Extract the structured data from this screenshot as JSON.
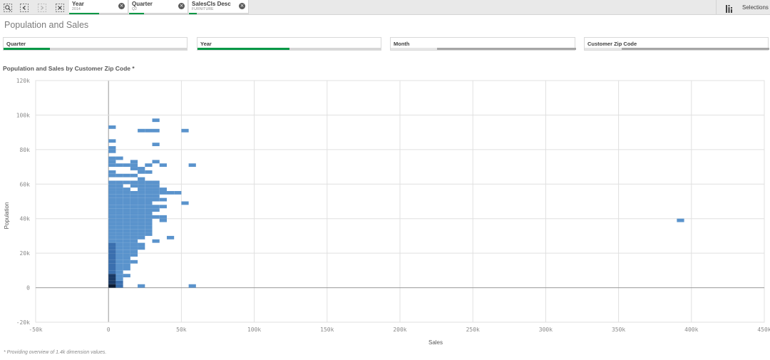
{
  "toolbar": {
    "icons": [
      "smart-search-icon",
      "step-back-icon",
      "step-forward-icon",
      "clear-selections-icon"
    ],
    "selections_label": "Selections",
    "selection_tabs": [
      {
        "title": "Year",
        "value": "2014",
        "progress": 0.5
      },
      {
        "title": "Quarter",
        "value": "Q2",
        "progress": 0.25
      },
      {
        "title": "SalesCls Desc",
        "value": "FURNITURE",
        "progress": 0.1
      }
    ]
  },
  "sheet": {
    "title": "Population and Sales"
  },
  "filters": [
    {
      "label": "Quarter",
      "selected_fraction": 0.25,
      "excluded_fraction": 0
    },
    {
      "label": "Year",
      "selected_fraction": 0.5,
      "excluded_fraction": 0
    },
    {
      "label": "Month",
      "selected_fraction": 0,
      "excluded_fraction": 0.75
    },
    {
      "label": "Customer Zip Code",
      "selected_fraction": 0,
      "excluded_fraction": 0.8
    }
  ],
  "chart": {
    "title": "Population and Sales by Customer Zip Code *",
    "footnote": "* Providing overview of 1.4k dimension values."
  },
  "chart_data": {
    "type": "heatmap",
    "title": "Population and Sales by Customer Zip Code *",
    "xlabel": "Sales",
    "ylabel": "Population",
    "xlim": [
      -50000,
      450000
    ],
    "ylim": [
      -20000,
      120000
    ],
    "x_ticks": [
      "-50k",
      "0",
      "50k",
      "100k",
      "150k",
      "200k",
      "250k",
      "300k",
      "350k",
      "400k",
      "450k"
    ],
    "y_ticks": [
      "-20k",
      "0",
      "20k",
      "40k",
      "60k",
      "80k",
      "100k",
      "120k"
    ],
    "grid": true,
    "bin_width": 5000,
    "bin_height": 2000,
    "colors": {
      "light": "#5a93cc",
      "mid": "#3a6fae",
      "dark": "#1a3a66",
      "darkest": "#0b1b33",
      "grid": "#e0e0e0",
      "axis_zero": "#9a9a9a"
    },
    "cells": [
      {
        "x": 0,
        "y": 0,
        "density": 4
      },
      {
        "x": 0,
        "y": 2000,
        "density": 3
      },
      {
        "x": 0,
        "y": 4000,
        "density": 3
      },
      {
        "x": 0,
        "y": 6000,
        "density": 3
      },
      {
        "x": 0,
        "y": 8000,
        "density": 2
      },
      {
        "x": 0,
        "y": 10000,
        "density": 2
      },
      {
        "x": 0,
        "y": 12000,
        "density": 2
      },
      {
        "x": 0,
        "y": 14000,
        "density": 2
      },
      {
        "x": 0,
        "y": 16000,
        "density": 2
      },
      {
        "x": 0,
        "y": 18000,
        "density": 2
      },
      {
        "x": 0,
        "y": 20000,
        "density": 2
      },
      {
        "x": 0,
        "y": 22000,
        "density": 2
      },
      {
        "x": 0,
        "y": 24000,
        "density": 2
      },
      {
        "x": 0,
        "y": 26000,
        "density": 1
      },
      {
        "x": 0,
        "y": 28000,
        "density": 1
      },
      {
        "x": 0,
        "y": 30000,
        "density": 1
      },
      {
        "x": 0,
        "y": 32000,
        "density": 1
      },
      {
        "x": 0,
        "y": 34000,
        "density": 1
      },
      {
        "x": 0,
        "y": 36000,
        "density": 1
      },
      {
        "x": 0,
        "y": 38000,
        "density": 1
      },
      {
        "x": 0,
        "y": 40000,
        "density": 1
      },
      {
        "x": 0,
        "y": 42000,
        "density": 1
      },
      {
        "x": 0,
        "y": 44000,
        "density": 1
      },
      {
        "x": 0,
        "y": 46000,
        "density": 1
      },
      {
        "x": 0,
        "y": 48000,
        "density": 1
      },
      {
        "x": 0,
        "y": 50000,
        "density": 1
      },
      {
        "x": 0,
        "y": 52000,
        "density": 1
      },
      {
        "x": 0,
        "y": 54000,
        "density": 1
      },
      {
        "x": 0,
        "y": 56000,
        "density": 1
      },
      {
        "x": 0,
        "y": 58000,
        "density": 1
      },
      {
        "x": 0,
        "y": 60000,
        "density": 1
      },
      {
        "x": 0,
        "y": 64000,
        "density": 1
      },
      {
        "x": 0,
        "y": 66000,
        "density": 1
      },
      {
        "x": 0,
        "y": 70000,
        "density": 1
      },
      {
        "x": 0,
        "y": 72000,
        "density": 1
      },
      {
        "x": 0,
        "y": 74000,
        "density": 1
      },
      {
        "x": 0,
        "y": 78000,
        "density": 1
      },
      {
        "x": 0,
        "y": 80000,
        "density": 1
      },
      {
        "x": 0,
        "y": 84000,
        "density": 1
      },
      {
        "x": 0,
        "y": 92000,
        "density": 1
      },
      {
        "x": 5000,
        "y": 0,
        "density": 2
      },
      {
        "x": 5000,
        "y": 2000,
        "density": 2
      },
      {
        "x": 5000,
        "y": 4000,
        "density": 1
      },
      {
        "x": 5000,
        "y": 6000,
        "density": 1
      },
      {
        "x": 5000,
        "y": 8000,
        "density": 1
      },
      {
        "x": 5000,
        "y": 10000,
        "density": 1
      },
      {
        "x": 5000,
        "y": 12000,
        "density": 1
      },
      {
        "x": 5000,
        "y": 14000,
        "density": 1
      },
      {
        "x": 5000,
        "y": 16000,
        "density": 1
      },
      {
        "x": 5000,
        "y": 18000,
        "density": 1
      },
      {
        "x": 5000,
        "y": 20000,
        "density": 1
      },
      {
        "x": 5000,
        "y": 22000,
        "density": 1
      },
      {
        "x": 5000,
        "y": 24000,
        "density": 1
      },
      {
        "x": 5000,
        "y": 26000,
        "density": 1
      },
      {
        "x": 5000,
        "y": 28000,
        "density": 1
      },
      {
        "x": 5000,
        "y": 30000,
        "density": 1
      },
      {
        "x": 5000,
        "y": 32000,
        "density": 1
      },
      {
        "x": 5000,
        "y": 34000,
        "density": 1
      },
      {
        "x": 5000,
        "y": 36000,
        "density": 1
      },
      {
        "x": 5000,
        "y": 38000,
        "density": 1
      },
      {
        "x": 5000,
        "y": 40000,
        "density": 1
      },
      {
        "x": 5000,
        "y": 42000,
        "density": 1
      },
      {
        "x": 5000,
        "y": 44000,
        "density": 1
      },
      {
        "x": 5000,
        "y": 46000,
        "density": 1
      },
      {
        "x": 5000,
        "y": 48000,
        "density": 1
      },
      {
        "x": 5000,
        "y": 50000,
        "density": 1
      },
      {
        "x": 5000,
        "y": 52000,
        "density": 1
      },
      {
        "x": 5000,
        "y": 54000,
        "density": 1
      },
      {
        "x": 5000,
        "y": 56000,
        "density": 1
      },
      {
        "x": 5000,
        "y": 58000,
        "density": 1
      },
      {
        "x": 5000,
        "y": 60000,
        "density": 1
      },
      {
        "x": 5000,
        "y": 64000,
        "density": 1
      },
      {
        "x": 5000,
        "y": 70000,
        "density": 1
      },
      {
        "x": 5000,
        "y": 74000,
        "density": 1
      },
      {
        "x": 10000,
        "y": 6000,
        "density": 1
      },
      {
        "x": 10000,
        "y": 10000,
        "density": 1
      },
      {
        "x": 10000,
        "y": 12000,
        "density": 1
      },
      {
        "x": 10000,
        "y": 14000,
        "density": 1
      },
      {
        "x": 10000,
        "y": 16000,
        "density": 1
      },
      {
        "x": 10000,
        "y": 18000,
        "density": 1
      },
      {
        "x": 10000,
        "y": 20000,
        "density": 1
      },
      {
        "x": 10000,
        "y": 22000,
        "density": 1
      },
      {
        "x": 10000,
        "y": 24000,
        "density": 1
      },
      {
        "x": 10000,
        "y": 26000,
        "density": 1
      },
      {
        "x": 10000,
        "y": 28000,
        "density": 1
      },
      {
        "x": 10000,
        "y": 30000,
        "density": 1
      },
      {
        "x": 10000,
        "y": 32000,
        "density": 1
      },
      {
        "x": 10000,
        "y": 34000,
        "density": 1
      },
      {
        "x": 10000,
        "y": 36000,
        "density": 1
      },
      {
        "x": 10000,
        "y": 38000,
        "density": 1
      },
      {
        "x": 10000,
        "y": 40000,
        "density": 1
      },
      {
        "x": 10000,
        "y": 42000,
        "density": 1
      },
      {
        "x": 10000,
        "y": 44000,
        "density": 1
      },
      {
        "x": 10000,
        "y": 46000,
        "density": 1
      },
      {
        "x": 10000,
        "y": 48000,
        "density": 1
      },
      {
        "x": 10000,
        "y": 50000,
        "density": 1
      },
      {
        "x": 10000,
        "y": 52000,
        "density": 1
      },
      {
        "x": 10000,
        "y": 54000,
        "density": 1
      },
      {
        "x": 10000,
        "y": 56000,
        "density": 1
      },
      {
        "x": 10000,
        "y": 60000,
        "density": 1
      },
      {
        "x": 10000,
        "y": 64000,
        "density": 1
      },
      {
        "x": 10000,
        "y": 70000,
        "density": 1
      },
      {
        "x": 15000,
        "y": 14000,
        "density": 1
      },
      {
        "x": 15000,
        "y": 18000,
        "density": 1
      },
      {
        "x": 15000,
        "y": 20000,
        "density": 1
      },
      {
        "x": 15000,
        "y": 22000,
        "density": 1
      },
      {
        "x": 15000,
        "y": 24000,
        "density": 1
      },
      {
        "x": 15000,
        "y": 26000,
        "density": 1
      },
      {
        "x": 15000,
        "y": 28000,
        "density": 1
      },
      {
        "x": 15000,
        "y": 30000,
        "density": 1
      },
      {
        "x": 15000,
        "y": 32000,
        "density": 1
      },
      {
        "x": 15000,
        "y": 34000,
        "density": 1
      },
      {
        "x": 15000,
        "y": 36000,
        "density": 1
      },
      {
        "x": 15000,
        "y": 38000,
        "density": 1
      },
      {
        "x": 15000,
        "y": 40000,
        "density": 1
      },
      {
        "x": 15000,
        "y": 42000,
        "density": 1
      },
      {
        "x": 15000,
        "y": 44000,
        "density": 1
      },
      {
        "x": 15000,
        "y": 46000,
        "density": 1
      },
      {
        "x": 15000,
        "y": 48000,
        "density": 1
      },
      {
        "x": 15000,
        "y": 50000,
        "density": 1
      },
      {
        "x": 15000,
        "y": 52000,
        "density": 1
      },
      {
        "x": 15000,
        "y": 54000,
        "density": 1
      },
      {
        "x": 15000,
        "y": 58000,
        "density": 1
      },
      {
        "x": 15000,
        "y": 60000,
        "density": 1
      },
      {
        "x": 15000,
        "y": 64000,
        "density": 1
      },
      {
        "x": 15000,
        "y": 68000,
        "density": 1
      },
      {
        "x": 15000,
        "y": 70000,
        "density": 1
      },
      {
        "x": 15000,
        "y": 72000,
        "density": 1
      },
      {
        "x": 20000,
        "y": 0,
        "density": 1
      },
      {
        "x": 20000,
        "y": 22000,
        "density": 1
      },
      {
        "x": 20000,
        "y": 24000,
        "density": 1
      },
      {
        "x": 20000,
        "y": 28000,
        "density": 1
      },
      {
        "x": 20000,
        "y": 30000,
        "density": 1
      },
      {
        "x": 20000,
        "y": 32000,
        "density": 1
      },
      {
        "x": 20000,
        "y": 34000,
        "density": 1
      },
      {
        "x": 20000,
        "y": 36000,
        "density": 1
      },
      {
        "x": 20000,
        "y": 38000,
        "density": 1
      },
      {
        "x": 20000,
        "y": 40000,
        "density": 1
      },
      {
        "x": 20000,
        "y": 42000,
        "density": 1
      },
      {
        "x": 20000,
        "y": 44000,
        "density": 1
      },
      {
        "x": 20000,
        "y": 46000,
        "density": 1
      },
      {
        "x": 20000,
        "y": 48000,
        "density": 1
      },
      {
        "x": 20000,
        "y": 50000,
        "density": 1
      },
      {
        "x": 20000,
        "y": 52000,
        "density": 1
      },
      {
        "x": 20000,
        "y": 54000,
        "density": 1
      },
      {
        "x": 20000,
        "y": 56000,
        "density": 1
      },
      {
        "x": 20000,
        "y": 58000,
        "density": 1
      },
      {
        "x": 20000,
        "y": 60000,
        "density": 1
      },
      {
        "x": 20000,
        "y": 62000,
        "density": 1
      },
      {
        "x": 20000,
        "y": 66000,
        "density": 1
      },
      {
        "x": 20000,
        "y": 68000,
        "density": 1
      },
      {
        "x": 20000,
        "y": 90000,
        "density": 1
      },
      {
        "x": 25000,
        "y": 30000,
        "density": 1
      },
      {
        "x": 25000,
        "y": 32000,
        "density": 1
      },
      {
        "x": 25000,
        "y": 34000,
        "density": 1
      },
      {
        "x": 25000,
        "y": 36000,
        "density": 1
      },
      {
        "x": 25000,
        "y": 38000,
        "density": 1
      },
      {
        "x": 25000,
        "y": 40000,
        "density": 1
      },
      {
        "x": 25000,
        "y": 42000,
        "density": 1
      },
      {
        "x": 25000,
        "y": 44000,
        "density": 1
      },
      {
        "x": 25000,
        "y": 46000,
        "density": 1
      },
      {
        "x": 25000,
        "y": 48000,
        "density": 1
      },
      {
        "x": 25000,
        "y": 50000,
        "density": 1
      },
      {
        "x": 25000,
        "y": 52000,
        "density": 1
      },
      {
        "x": 25000,
        "y": 54000,
        "density": 1
      },
      {
        "x": 25000,
        "y": 56000,
        "density": 1
      },
      {
        "x": 25000,
        "y": 58000,
        "density": 1
      },
      {
        "x": 25000,
        "y": 60000,
        "density": 1
      },
      {
        "x": 25000,
        "y": 66000,
        "density": 1
      },
      {
        "x": 25000,
        "y": 70000,
        "density": 1
      },
      {
        "x": 25000,
        "y": 90000,
        "density": 1
      },
      {
        "x": 30000,
        "y": 26000,
        "density": 1
      },
      {
        "x": 30000,
        "y": 40000,
        "density": 1
      },
      {
        "x": 30000,
        "y": 44000,
        "density": 1
      },
      {
        "x": 30000,
        "y": 46000,
        "density": 1
      },
      {
        "x": 30000,
        "y": 50000,
        "density": 1
      },
      {
        "x": 30000,
        "y": 52000,
        "density": 1
      },
      {
        "x": 30000,
        "y": 54000,
        "density": 1
      },
      {
        "x": 30000,
        "y": 56000,
        "density": 1
      },
      {
        "x": 30000,
        "y": 58000,
        "density": 1
      },
      {
        "x": 30000,
        "y": 60000,
        "density": 1
      },
      {
        "x": 30000,
        "y": 72000,
        "density": 1
      },
      {
        "x": 30000,
        "y": 82000,
        "density": 1
      },
      {
        "x": 30000,
        "y": 90000,
        "density": 1
      },
      {
        "x": 30000,
        "y": 96000,
        "density": 1
      },
      {
        "x": 35000,
        "y": 38000,
        "density": 1
      },
      {
        "x": 35000,
        "y": 40000,
        "density": 1
      },
      {
        "x": 35000,
        "y": 46000,
        "density": 1
      },
      {
        "x": 35000,
        "y": 50000,
        "density": 1
      },
      {
        "x": 35000,
        "y": 54000,
        "density": 1
      },
      {
        "x": 35000,
        "y": 56000,
        "density": 1
      },
      {
        "x": 35000,
        "y": 70000,
        "density": 1
      },
      {
        "x": 40000,
        "y": 28000,
        "density": 1
      },
      {
        "x": 40000,
        "y": 54000,
        "density": 1
      },
      {
        "x": 45000,
        "y": 54000,
        "density": 1
      },
      {
        "x": 50000,
        "y": 48000,
        "density": 1
      },
      {
        "x": 50000,
        "y": 90000,
        "density": 1
      },
      {
        "x": 55000,
        "y": 0,
        "density": 1
      },
      {
        "x": 55000,
        "y": 70000,
        "density": 1
      },
      {
        "x": 390000,
        "y": 38000,
        "density": 1
      }
    ]
  }
}
